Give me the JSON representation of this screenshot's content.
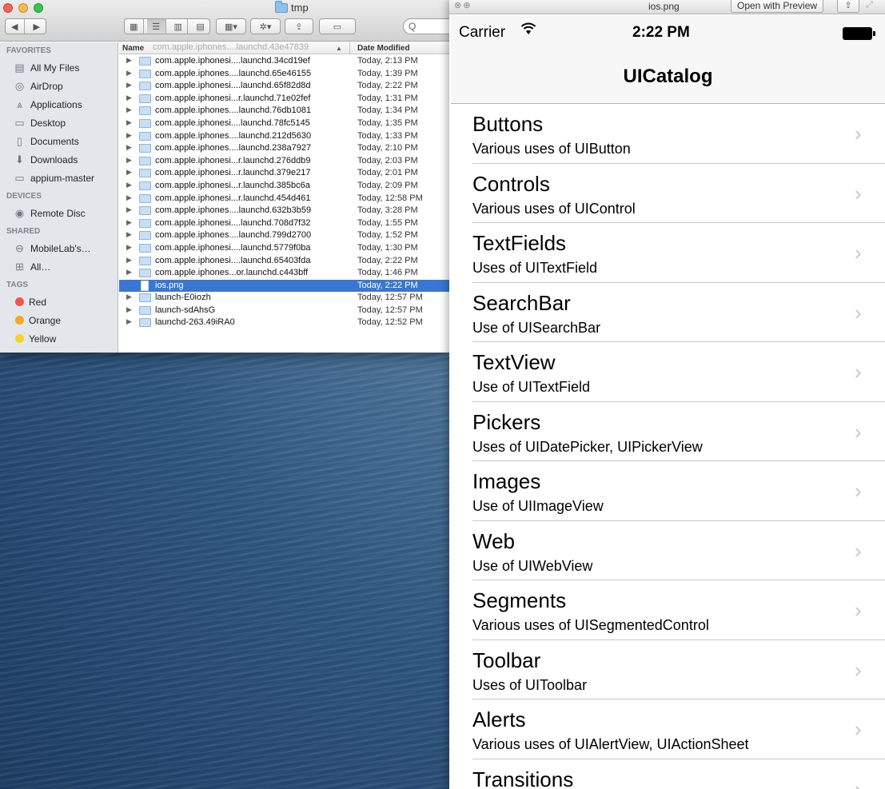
{
  "finder": {
    "title": "tmp",
    "search_placeholder": "Q",
    "sidebar": {
      "favorites_label": "FAVORITES",
      "favorites": [
        {
          "label": "All My Files",
          "icon": "all-files-icon"
        },
        {
          "label": "AirDrop",
          "icon": "airdrop-icon"
        },
        {
          "label": "Applications",
          "icon": "applications-icon"
        },
        {
          "label": "Desktop",
          "icon": "desktop-icon"
        },
        {
          "label": "Documents",
          "icon": "documents-icon"
        },
        {
          "label": "Downloads",
          "icon": "downloads-icon"
        },
        {
          "label": "appium-master",
          "icon": "folder-icon"
        }
      ],
      "devices_label": "DEVICES",
      "devices": [
        {
          "label": "Remote Disc",
          "icon": "disc-icon"
        }
      ],
      "shared_label": "SHARED",
      "shared": [
        {
          "label": "MobileLab's…",
          "icon": "server-icon"
        },
        {
          "label": "All…",
          "icon": "network-icon"
        }
      ],
      "tags_label": "TAGS",
      "tags": [
        {
          "label": "Red",
          "color": "#f2544d"
        },
        {
          "label": "Orange",
          "color": "#f6a623"
        },
        {
          "label": "Yellow",
          "color": "#f5d328"
        }
      ]
    },
    "list": {
      "col_name": "Name",
      "col_date": "Date Modified",
      "header_ghost": "com.apple.iphones....launchd.43e47839",
      "rows": [
        {
          "name": "com.apple.iphonesi....launchd.34cd19ef",
          "date": "Today, 2:13 PM",
          "type": "folder"
        },
        {
          "name": "com.apple.iphones....launchd.65e46155",
          "date": "Today, 1:39 PM",
          "type": "folder"
        },
        {
          "name": "com.apple.iphonesi....launchd.65f82d8d",
          "date": "Today, 2:22 PM",
          "type": "folder"
        },
        {
          "name": "com.apple.iphonesi...r.launchd.71e02fef",
          "date": "Today, 1:31 PM",
          "type": "folder"
        },
        {
          "name": "com.apple.iphones....launchd.76db1081",
          "date": "Today, 1:34 PM",
          "type": "folder"
        },
        {
          "name": "com.apple.iphonesi....launchd.78fc5145",
          "date": "Today, 1:35 PM",
          "type": "folder"
        },
        {
          "name": "com.apple.iphones....launchd.212d5630",
          "date": "Today, 1:33 PM",
          "type": "folder"
        },
        {
          "name": "com.apple.iphones....launchd.238a7927",
          "date": "Today, 2:10 PM",
          "type": "folder"
        },
        {
          "name": "com.apple.iphonesi...r.launchd.276ddb9",
          "date": "Today, 2:03 PM",
          "type": "folder"
        },
        {
          "name": "com.apple.iphonesi...r.launchd.379e217",
          "date": "Today, 2:01 PM",
          "type": "folder"
        },
        {
          "name": "com.apple.iphonesi...r.launchd.385bc6a",
          "date": "Today, 2:09 PM",
          "type": "folder"
        },
        {
          "name": "com.apple.iphonesi...r.launchd.454d461",
          "date": "Today, 12:58 PM",
          "type": "folder"
        },
        {
          "name": "com.apple.iphones....launchd.632b3b59",
          "date": "Today, 3:28 PM",
          "type": "folder"
        },
        {
          "name": "com.apple.iphonesi....launchd.708d7f32",
          "date": "Today, 1:55 PM",
          "type": "folder"
        },
        {
          "name": "com.apple.iphones....launchd.799d2700",
          "date": "Today, 1:52 PM",
          "type": "folder"
        },
        {
          "name": "com.apple.iphonesi....launchd.5779f0ba",
          "date": "Today, 1:30 PM",
          "type": "folder"
        },
        {
          "name": "com.apple.iphonesi....launchd.65403fda",
          "date": "Today, 2:22 PM",
          "type": "folder"
        },
        {
          "name": "com.apple.iphones...or.launchd.c443bff",
          "date": "Today, 1:46 PM",
          "type": "folder"
        },
        {
          "name": "ios.png",
          "date": "Today, 2:22 PM",
          "type": "file",
          "selected": true
        },
        {
          "name": "launch-E0iozh",
          "date": "Today, 12:57 PM",
          "type": "folder"
        },
        {
          "name": "launch-sdAhsG",
          "date": "Today, 12:57 PM",
          "type": "folder"
        },
        {
          "name": "launchd-263.49iRA0",
          "date": "Today, 12:52 PM",
          "type": "folder"
        }
      ]
    }
  },
  "preview": {
    "title": "ios.png",
    "open_with_label": "Open with Preview",
    "share_icon": "share-icon",
    "ios": {
      "carrier": "Carrier",
      "time": "2:22 PM",
      "nav_title": "UICatalog",
      "items": [
        {
          "title": "Buttons",
          "subtitle": "Various uses of UIButton"
        },
        {
          "title": "Controls",
          "subtitle": "Various uses of UIControl"
        },
        {
          "title": "TextFields",
          "subtitle": "Uses of UITextField"
        },
        {
          "title": "SearchBar",
          "subtitle": "Use of UISearchBar"
        },
        {
          "title": "TextView",
          "subtitle": "Use of UITextField"
        },
        {
          "title": "Pickers",
          "subtitle": "Uses of UIDatePicker, UIPickerView"
        },
        {
          "title": "Images",
          "subtitle": "Use of UIImageView"
        },
        {
          "title": "Web",
          "subtitle": "Use of UIWebView"
        },
        {
          "title": "Segments",
          "subtitle": "Various uses of UISegmentedControl"
        },
        {
          "title": "Toolbar",
          "subtitle": "Uses of UIToolbar"
        },
        {
          "title": "Alerts",
          "subtitle": "Various uses of UIAlertView, UIActionSheet"
        },
        {
          "title": "Transitions",
          "subtitle": ""
        }
      ]
    }
  }
}
